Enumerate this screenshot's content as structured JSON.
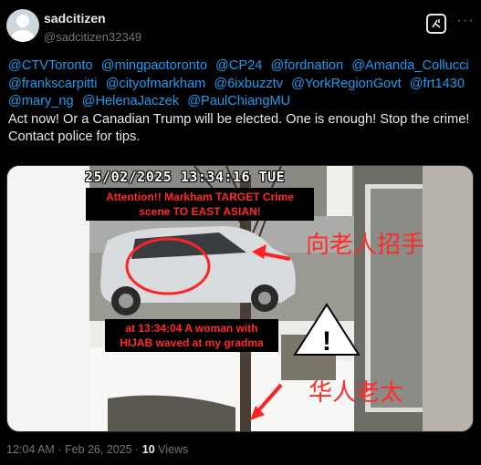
{
  "author": {
    "display_name": "sadcitizen",
    "handle": "@sadcitizen32349"
  },
  "tweet": {
    "mentions": [
      "@CTVToronto",
      "@mingpaotoronto",
      "@CP24",
      "@fordnation",
      "@Amanda_Collucci",
      "@frankscarpitti",
      "@cityofmarkham",
      "@6ixbuzztv",
      "@YorkRegionGovt",
      "@frt1430",
      "@mary_ng",
      "@HelenaJaczek",
      "@PaulChiangMU"
    ],
    "body": "Act now! Or a Canadian Trump will be elected. One is enough! Stop the crime! Contact police for tips."
  },
  "media": {
    "timestamp": "25/02/2025 13:34:16 TUE",
    "caption_top": "Attention!! Markham TARGET Crime scene TO EAST ASIAN!",
    "caption_bottom": "at 13:34:04 A woman with HIJAB waved at my gradma",
    "annotation_wave": "向老人招手",
    "annotation_grandma": "华人老太",
    "warning_symbol": "!"
  },
  "footer": {
    "time": "12:04 AM",
    "separator": "·",
    "date": "Feb 26, 2025",
    "views_count": "10",
    "views_label": "Views"
  },
  "icons": [
    "grok-icon",
    "more-icon",
    "warning-icon",
    "arrow-icon"
  ],
  "colors": {
    "background": "#000000",
    "text": "#e7e9ea",
    "muted": "#71767b",
    "link": "#1d9bf0",
    "annotation_red": "#ff2b2b"
  }
}
